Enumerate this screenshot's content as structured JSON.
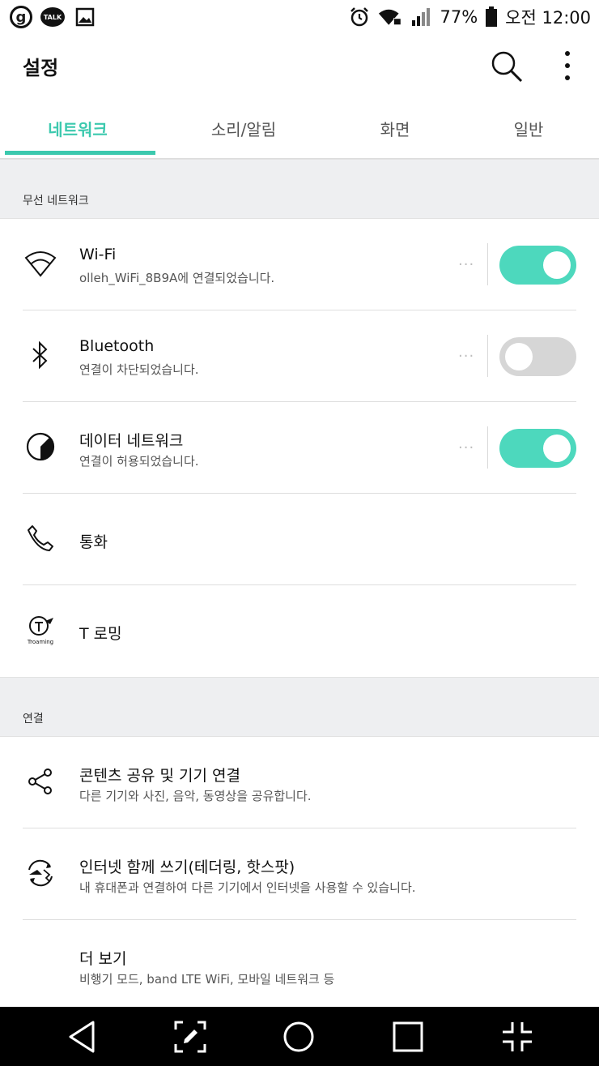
{
  "status_bar": {
    "battery": "77%",
    "time": "오전 12:00",
    "talk_label": "TALK",
    "g_label": "g",
    "icons": [
      "g-icon",
      "kakaotalk-icon",
      "gallery-icon",
      "alarm-icon",
      "wifi-lock-icon",
      "signal-icon",
      "battery-icon"
    ]
  },
  "app_bar": {
    "title": "설정",
    "search_icon": "search-icon",
    "more_icon": "more-vert-icon"
  },
  "tabs": [
    {
      "label": "네트워크",
      "active": true
    },
    {
      "label": "소리/알림",
      "active": false
    },
    {
      "label": "화면",
      "active": false
    },
    {
      "label": "일반",
      "active": false
    }
  ],
  "sections": {
    "wireless": {
      "header": "무선 네트워크",
      "items": [
        {
          "title": "Wi-Fi",
          "subtitle": "olleh_WiFi_8B9A에 연결되었습니다.",
          "icon": "wifi-icon",
          "toggle": true
        },
        {
          "title": "Bluetooth",
          "subtitle": "연결이 차단되었습니다.",
          "icon": "bluetooth-icon",
          "toggle": false
        },
        {
          "title": "데이터 네트워크",
          "subtitle": "연결이 허용되었습니다.",
          "icon": "data-usage-icon",
          "toggle": true
        },
        {
          "title": "통화",
          "icon": "phone-icon"
        },
        {
          "title": "T 로밍",
          "icon": "troaming-icon",
          "icon_caption": "Troaming"
        }
      ]
    },
    "connection": {
      "header": "연결",
      "items": [
        {
          "title": "콘텐츠 공유 및 기기 연결",
          "subtitle": "다른 기기와 사진, 음악, 동영상을 공유합니다.",
          "icon": "share-icon"
        },
        {
          "title": "인터넷 함께 쓰기(테더링, 핫스팟)",
          "subtitle": "내 휴대폰과 연결하여 다른 기기에서 인터넷을 사용할 수 있습니다.",
          "icon": "tethering-icon"
        },
        {
          "title": "더 보기",
          "subtitle": "비행기 모드, band LTE WiFi, 모바일 네트워크 등"
        }
      ]
    }
  },
  "overflow_dots": "···",
  "nav_bar": {
    "icons": [
      "back-icon",
      "capture-icon",
      "home-icon",
      "recents-icon",
      "minimize-icon"
    ]
  },
  "colors": {
    "accent": "#3cc9ae",
    "toggle_on": "#4dd8bd",
    "toggle_off": "#d6d6d6",
    "section_bg": "#eeeff1",
    "nav_bg": "#000000"
  }
}
